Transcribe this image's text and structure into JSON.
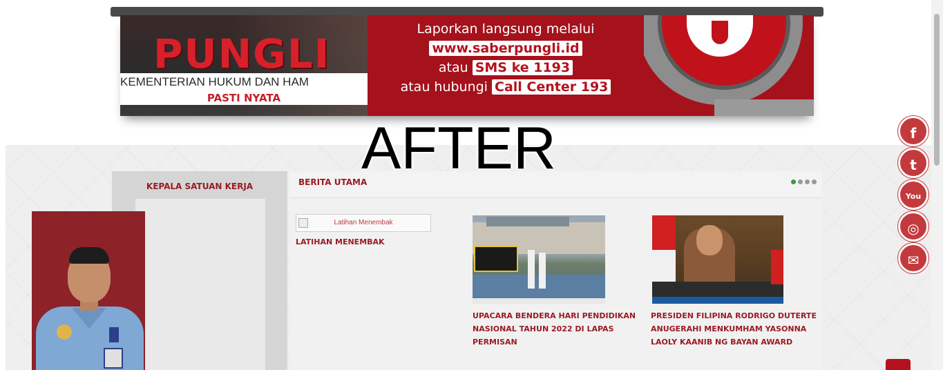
{
  "banner": {
    "brand_word": "PUNGLI",
    "ministry": "KEMENTERIAN HUKUM DAN HAM",
    "tagline": "PASTI NYATA",
    "report_line": "Laporkan langsung melalui",
    "website": "www.saberpungli.id",
    "or_1": "atau",
    "sms": "SMS ke 1193",
    "call_prefix": "atau hubungi",
    "call_center": "Call Center 193"
  },
  "overlay": {
    "label": "AFTER"
  },
  "sidebar": {
    "title": "KEPALA SATUAN KERJA"
  },
  "news": {
    "title": "BERITA UTAMA",
    "items": [
      {
        "image_alt": "Latihan Menembak",
        "caption": "LATIHAN MENEMBAK"
      },
      {
        "caption": "UPACARA BENDERA HARI PENDIDIKAN NASIONAL TAHUN 2022 DI LAPAS PERMISAN"
      },
      {
        "caption": "PRESIDEN FILIPINA RODRIGO DUTERTE ANUGERAHI MENKUMHAM YASONNA LAOLY KAANIB NG BAYAN AWARD"
      }
    ]
  },
  "social": {
    "facebook": "f",
    "twitter": "t",
    "youtube": "You",
    "instagram": "◎",
    "email": "✉"
  },
  "colors": {
    "brand_red": "#a5121c",
    "text_red": "#9a1b24",
    "social_red": "#c33a3d"
  }
}
